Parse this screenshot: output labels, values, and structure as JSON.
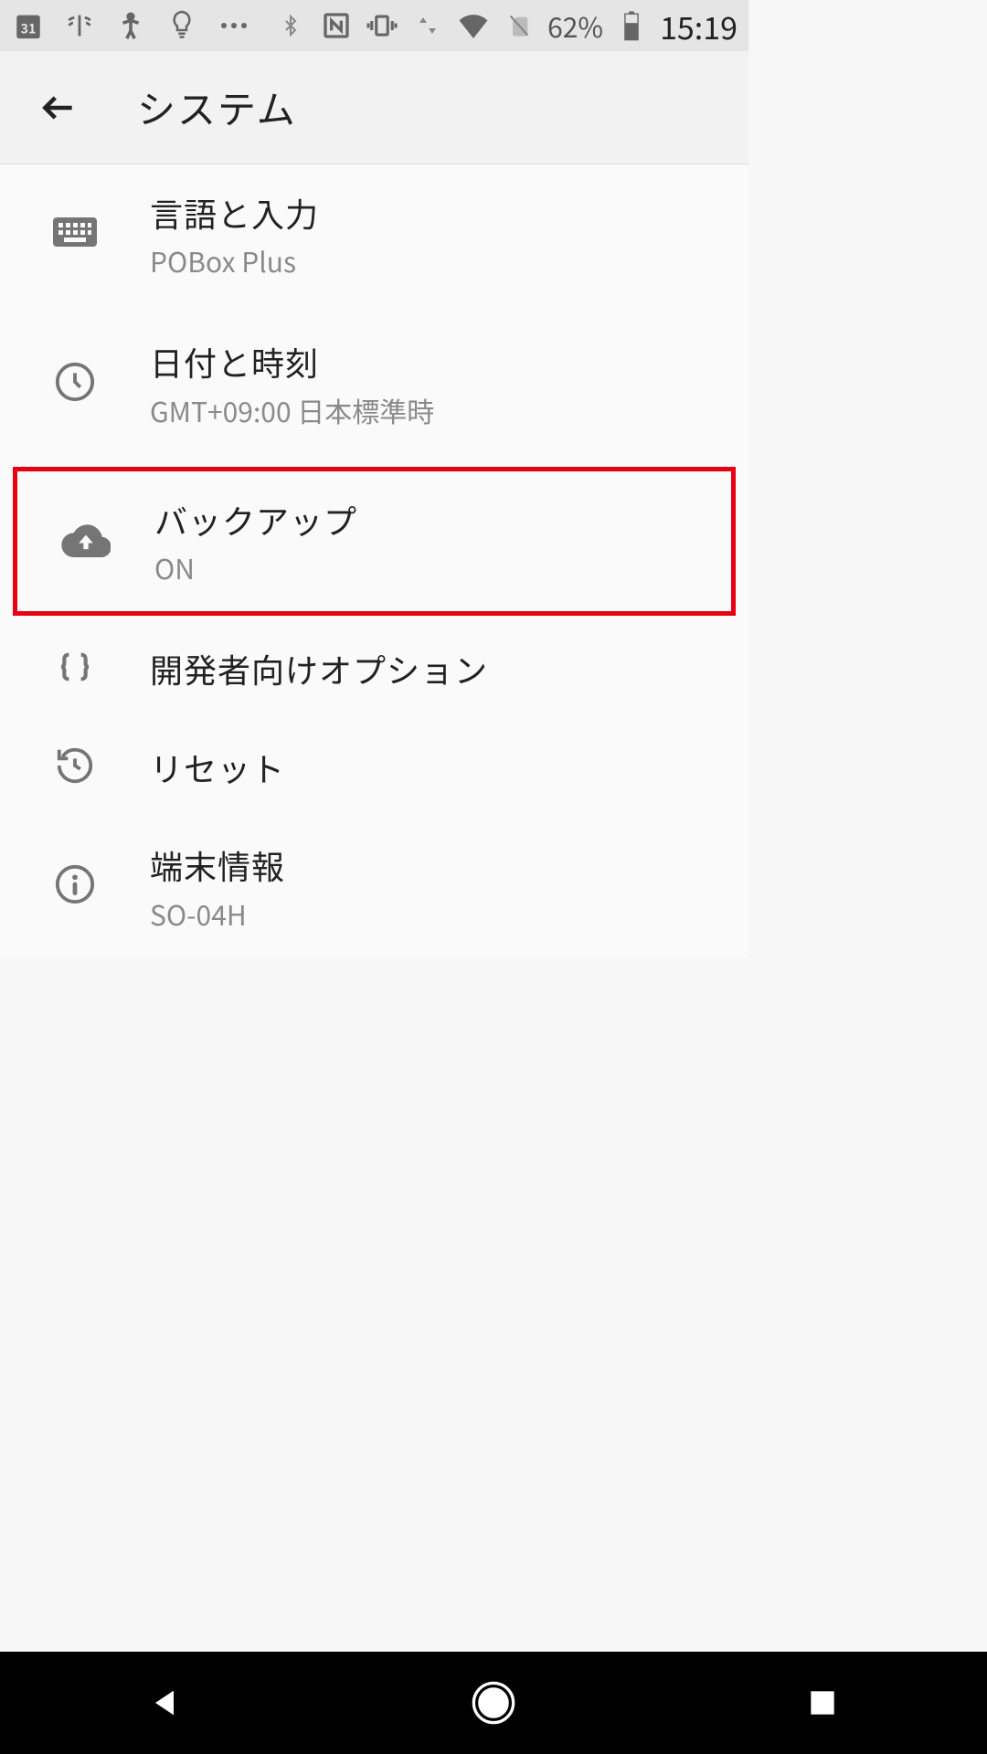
{
  "status": {
    "battery_pct": "62%",
    "clock": "15:19"
  },
  "header": {
    "title": "システム"
  },
  "settings": [
    {
      "title": "言語と入力",
      "subtitle": "POBox Plus"
    },
    {
      "title": "日付と時刻",
      "subtitle": "GMT+09:00 日本標準時"
    },
    {
      "title": "バックアップ",
      "subtitle": "ON"
    },
    {
      "title": "開発者向けオプション",
      "subtitle": ""
    },
    {
      "title": "リセット",
      "subtitle": ""
    },
    {
      "title": "端末情報",
      "subtitle": "SO-04H"
    }
  ]
}
